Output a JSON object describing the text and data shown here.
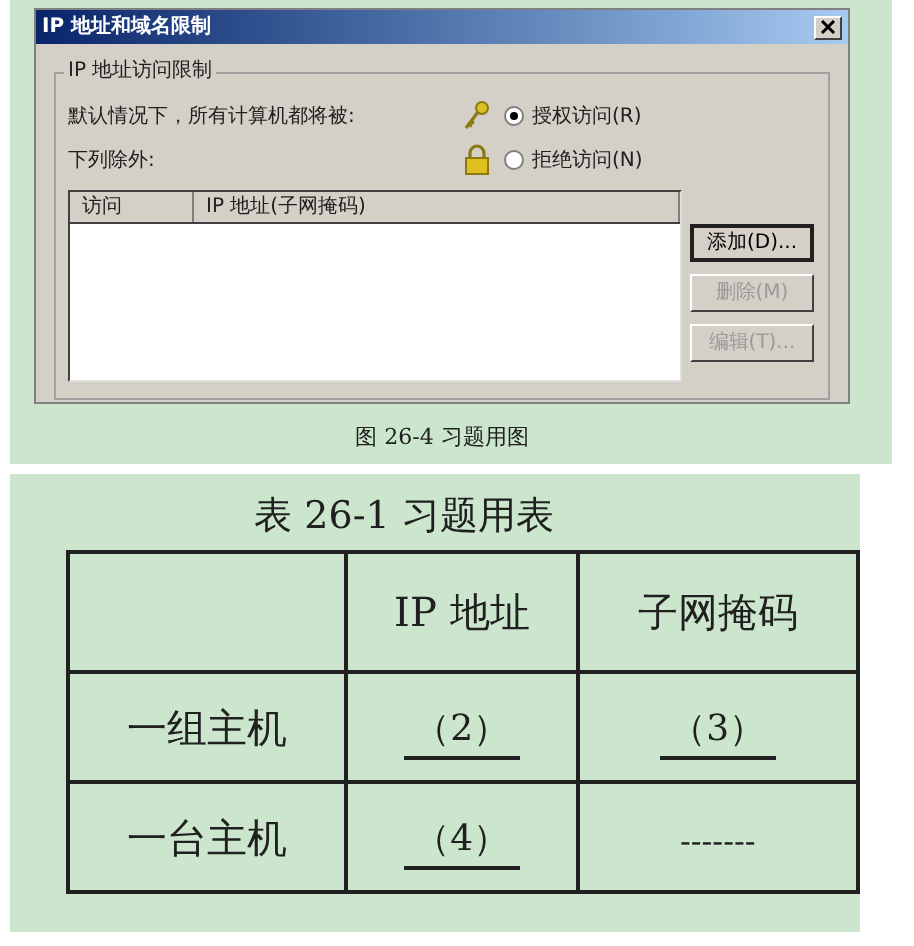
{
  "dialog": {
    "title": "IP 地址和域名限制",
    "group_title": "IP 地址访问限制",
    "default_label": "默认情况下，所有计算机都将被:",
    "exceptions_label": "下列除外:",
    "radios": [
      {
        "label": "授权访问(R)",
        "selected": true,
        "kind": "key"
      },
      {
        "label": "拒绝访问(N)",
        "selected": false,
        "kind": "lock"
      }
    ],
    "list_columns": [
      "访问",
      "IP 地址(子网掩码)"
    ],
    "buttons": [
      {
        "label": "添加(D)...",
        "disabled": false,
        "default": true
      },
      {
        "label": "删除(M)",
        "disabled": true,
        "default": false
      },
      {
        "label": "编辑(T)...",
        "disabled": true,
        "default": false
      }
    ]
  },
  "figure_caption": "图 26-4 习题用图",
  "table": {
    "title": "表 26-1 习题用表",
    "columns": [
      "IP 地址",
      "子网掩码"
    ],
    "rows": [
      {
        "header": "一组主机",
        "cells": [
          {
            "text": "（2）",
            "kind": "blank"
          },
          {
            "text": "（3）",
            "kind": "blank"
          }
        ]
      },
      {
        "header": "一台主机",
        "cells": [
          {
            "text": "（4）",
            "kind": "blank"
          },
          {
            "text": "-------",
            "kind": "text"
          }
        ]
      }
    ]
  }
}
